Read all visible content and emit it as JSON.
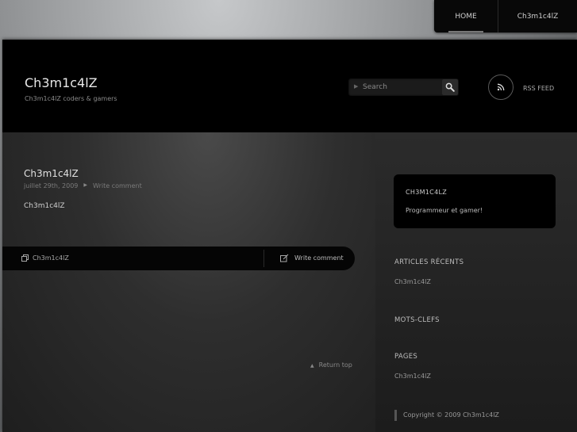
{
  "topnav": {
    "items": [
      {
        "label": "HOME"
      },
      {
        "label": "Ch3m1c4lZ"
      }
    ]
  },
  "header": {
    "title": "Ch3m1c4lZ",
    "description": "Ch3m1c4lZ coders & gamers",
    "search": {
      "placeholder": "Search"
    },
    "rss_label": "RSS FEED"
  },
  "post": {
    "title": "Ch3m1c4lZ",
    "date": "juillet 29th, 2009",
    "comment_link": "Write comment",
    "body": "Ch3m1c4lZ",
    "category": "Ch3m1c4lZ",
    "write_comment": "Write comment"
  },
  "return_top": "Return top",
  "sidebar": {
    "box": {
      "heading": "CH3M1C4LZ",
      "text": "Programmeur et gamer!"
    },
    "recent": {
      "heading": "ARTICLES RÉCENTS",
      "items": [
        "Ch3m1c4lZ"
      ]
    },
    "tags": {
      "heading": "MOTS-CLEFS"
    },
    "pages": {
      "heading": "PAGES",
      "items": [
        "Ch3m1c4lZ"
      ]
    },
    "copyright": "Copyright ©  2009  Ch3m1c4lZ"
  }
}
